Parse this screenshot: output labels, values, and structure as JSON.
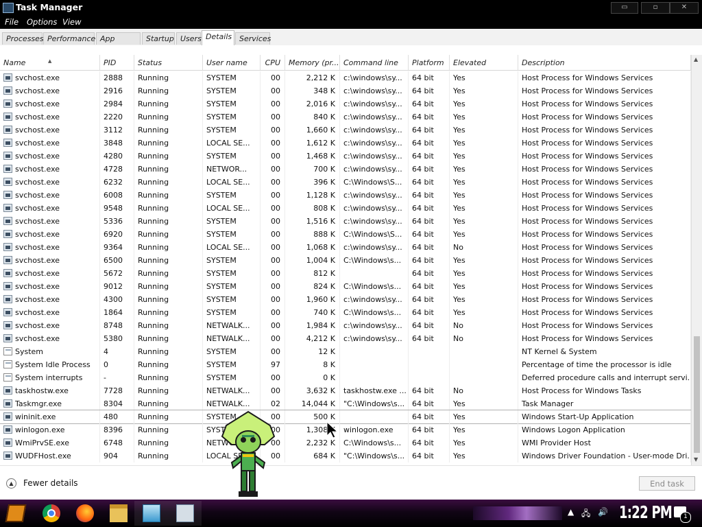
{
  "window": {
    "title": "Task Manager",
    "icon": "task-manager-icon",
    "controls": {
      "minimize": "▭",
      "maximize": "▫",
      "close": "✕"
    }
  },
  "menu": [
    "File",
    "Options",
    "View"
  ],
  "tabs": [
    {
      "label": "Processes",
      "active": false
    },
    {
      "label": "Performance",
      "active": false
    },
    {
      "label": "App history",
      "active": false
    },
    {
      "label": "Startup",
      "active": false
    },
    {
      "label": "Users",
      "active": false
    },
    {
      "label": "Details",
      "active": true
    },
    {
      "label": "Services",
      "active": false
    }
  ],
  "columns": [
    "Name",
    "PID",
    "Status",
    "User name",
    "CPU",
    "Memory (pr...",
    "Command line",
    "Platform",
    "Elevated",
    "Description"
  ],
  "sorted_column": "Name",
  "rows": [
    [
      "svchost.exe",
      "2888",
      "Running",
      "SYSTEM",
      "00",
      "2,212 K",
      "c:\\windows\\sy...",
      "64 bit",
      "Yes",
      "Host Process for Windows Services"
    ],
    [
      "svchost.exe",
      "2916",
      "Running",
      "SYSTEM",
      "00",
      "348 K",
      "c:\\windows\\sy...",
      "64 bit",
      "Yes",
      "Host Process for Windows Services"
    ],
    [
      "svchost.exe",
      "2984",
      "Running",
      "SYSTEM",
      "00",
      "2,016 K",
      "c:\\windows\\sy...",
      "64 bit",
      "Yes",
      "Host Process for Windows Services"
    ],
    [
      "svchost.exe",
      "2220",
      "Running",
      "SYSTEM",
      "00",
      "840 K",
      "c:\\windows\\sy...",
      "64 bit",
      "Yes",
      "Host Process for Windows Services"
    ],
    [
      "svchost.exe",
      "3112",
      "Running",
      "SYSTEM",
      "00",
      "1,660 K",
      "c:\\windows\\sy...",
      "64 bit",
      "Yes",
      "Host Process for Windows Services"
    ],
    [
      "svchost.exe",
      "3848",
      "Running",
      "LOCAL SE...",
      "00",
      "1,612 K",
      "c:\\windows\\sy...",
      "64 bit",
      "Yes",
      "Host Process for Windows Services"
    ],
    [
      "svchost.exe",
      "4280",
      "Running",
      "SYSTEM",
      "00",
      "1,468 K",
      "c:\\windows\\sy...",
      "64 bit",
      "Yes",
      "Host Process for Windows Services"
    ],
    [
      "svchost.exe",
      "4728",
      "Running",
      "NETWOR...",
      "00",
      "700 K",
      "c:\\windows\\sy...",
      "64 bit",
      "Yes",
      "Host Process for Windows Services"
    ],
    [
      "svchost.exe",
      "6232",
      "Running",
      "LOCAL SE...",
      "00",
      "396 K",
      "C:\\Windows\\S...",
      "64 bit",
      "Yes",
      "Host Process for Windows Services"
    ],
    [
      "svchost.exe",
      "6008",
      "Running",
      "SYSTEM",
      "00",
      "1,128 K",
      "c:\\windows\\sy...",
      "64 bit",
      "Yes",
      "Host Process for Windows Services"
    ],
    [
      "svchost.exe",
      "9548",
      "Running",
      "LOCAL SE...",
      "00",
      "808 K",
      "c:\\windows\\sy...",
      "64 bit",
      "Yes",
      "Host Process for Windows Services"
    ],
    [
      "svchost.exe",
      "5336",
      "Running",
      "SYSTEM",
      "00",
      "1,516 K",
      "c:\\windows\\sy...",
      "64 bit",
      "Yes",
      "Host Process for Windows Services"
    ],
    [
      "svchost.exe",
      "6920",
      "Running",
      "SYSTEM",
      "00",
      "888 K",
      "C:\\Windows\\S...",
      "64 bit",
      "Yes",
      "Host Process for Windows Services"
    ],
    [
      "svchost.exe",
      "9364",
      "Running",
      "LOCAL SE...",
      "00",
      "1,068 K",
      "c:\\windows\\sy...",
      "64 bit",
      "No",
      "Host Process for Windows Services"
    ],
    [
      "svchost.exe",
      "6500",
      "Running",
      "SYSTEM",
      "00",
      "1,004 K",
      "C:\\Windows\\s...",
      "64 bit",
      "Yes",
      "Host Process for Windows Services"
    ],
    [
      "svchost.exe",
      "5672",
      "Running",
      "SYSTEM",
      "00",
      "812 K",
      "",
      "64 bit",
      "Yes",
      "Host Process for Windows Services"
    ],
    [
      "svchost.exe",
      "9012",
      "Running",
      "SYSTEM",
      "00",
      "824 K",
      "C:\\Windows\\s...",
      "64 bit",
      "Yes",
      "Host Process for Windows Services"
    ],
    [
      "svchost.exe",
      "4300",
      "Running",
      "SYSTEM",
      "00",
      "1,960 K",
      "c:\\windows\\sy...",
      "64 bit",
      "Yes",
      "Host Process for Windows Services"
    ],
    [
      "svchost.exe",
      "1864",
      "Running",
      "SYSTEM",
      "00",
      "740 K",
      "C:\\Windows\\s...",
      "64 bit",
      "Yes",
      "Host Process for Windows Services"
    ],
    [
      "svchost.exe",
      "8748",
      "Running",
      "NETWALK...",
      "00",
      "1,984 K",
      "c:\\windows\\sy...",
      "64 bit",
      "No",
      "Host Process for Windows Services"
    ],
    [
      "svchost.exe",
      "5380",
      "Running",
      "NETWALK...",
      "00",
      "4,212 K",
      "c:\\windows\\sy...",
      "64 bit",
      "No",
      "Host Process for Windows Services"
    ],
    [
      "System",
      "4",
      "Running",
      "SYSTEM",
      "00",
      "12 K",
      "",
      "",
      "",
      "NT Kernel & System"
    ],
    [
      "System Idle Process",
      "0",
      "Running",
      "SYSTEM",
      "97",
      "8 K",
      "",
      "",
      "",
      "Percentage of time the processor is idle"
    ],
    [
      "System interrupts",
      "-",
      "Running",
      "SYSTEM",
      "00",
      "0 K",
      "",
      "",
      "",
      "Deferred procedure calls and interrupt servi..."
    ],
    [
      "taskhostw.exe",
      "7728",
      "Running",
      "NETWALK...",
      "00",
      "3,632 K",
      "taskhostw.exe ...",
      "64 bit",
      "No",
      "Host Process for Windows Tasks"
    ],
    [
      "Taskmgr.exe",
      "8304",
      "Running",
      "NETWALK...",
      "02",
      "14,044 K",
      "\"C:\\Windows\\s...",
      "64 bit",
      "Yes",
      "Task Manager"
    ],
    [
      "wininit.exe",
      "480",
      "Running",
      "SYSTEM",
      "00",
      "500 K",
      "",
      "64 bit",
      "Yes",
      "Windows Start-Up Application"
    ],
    [
      "winlogon.exe",
      "8396",
      "Running",
      "SYSTEM",
      "00",
      "1,308 K",
      "winlogon.exe",
      "64 bit",
      "Yes",
      "Windows Logon Application"
    ],
    [
      "WmiPrvSE.exe",
      "6748",
      "Running",
      "NETWORK...",
      "00",
      "2,232 K",
      "C:\\Windows\\s...",
      "64 bit",
      "Yes",
      "WMI Provider Host"
    ],
    [
      "WUDFHost.exe",
      "904",
      "Running",
      "LOCAL SE...",
      "00",
      "684 K",
      "\"C:\\Windows\\s...",
      "64 bit",
      "Yes",
      "Windows Driver Foundation - User-mode Dri..."
    ]
  ],
  "selected_row": "wininit.exe",
  "footer": {
    "fewer_details": "Fewer details",
    "end_task": "End task"
  },
  "taskbar": {
    "clock": "1:22 PM",
    "notification_count": "1",
    "apps": [
      "start-icon",
      "chrome-icon",
      "firefox-icon",
      "file-explorer-icon",
      "app-icon",
      "task-manager-icon"
    ]
  }
}
